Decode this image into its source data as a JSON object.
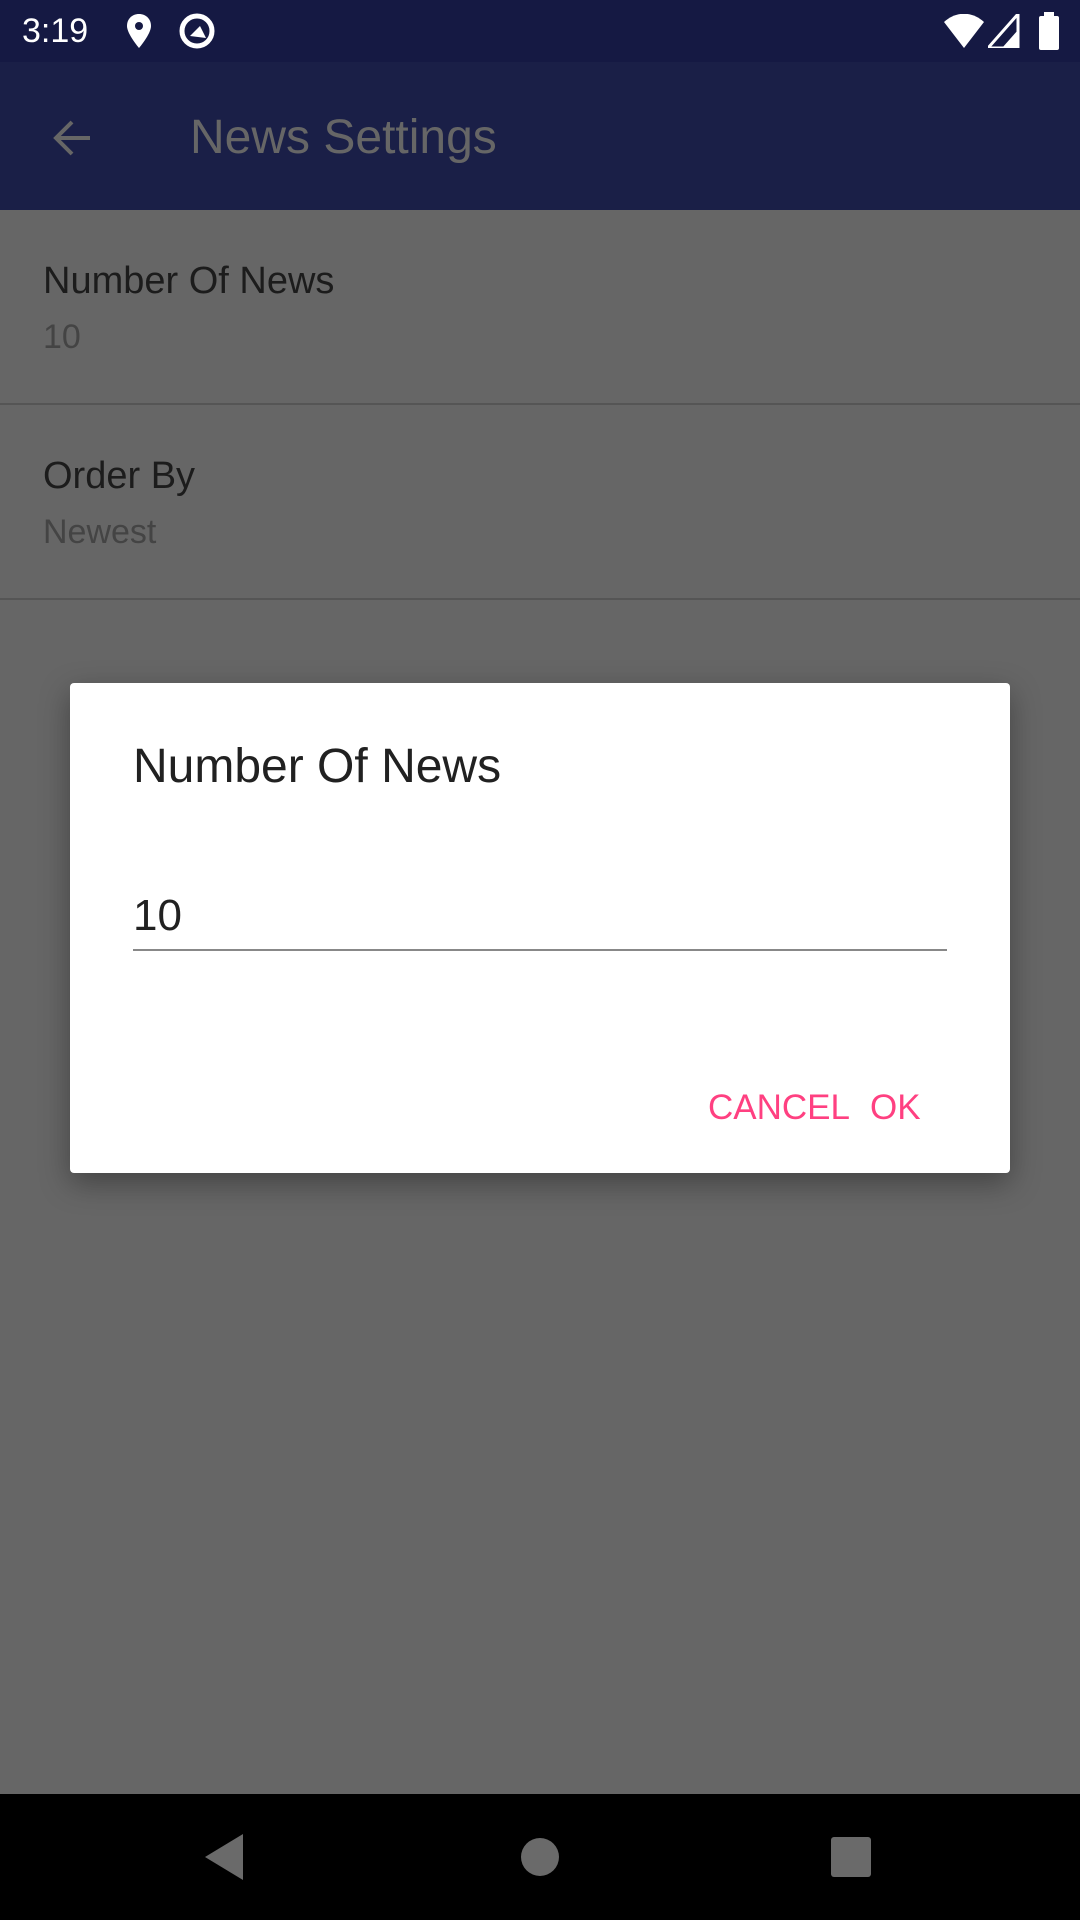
{
  "status_bar": {
    "time": "3:19",
    "icons": [
      "location-icon",
      "sync-icon",
      "wifi-icon",
      "signal-icon",
      "battery-icon"
    ]
  },
  "app_bar": {
    "title": "News Settings",
    "back_icon": "arrow-back-icon"
  },
  "settings": [
    {
      "title": "Number Of News",
      "value": "10"
    },
    {
      "title": "Order By",
      "value": "Newest"
    }
  ],
  "dialog": {
    "title": "Number Of News",
    "input_value": "10",
    "cancel_label": "CANCEL",
    "ok_label": "OK"
  },
  "colors": {
    "accent": "#ff4081",
    "primary": "#1a1f47"
  }
}
